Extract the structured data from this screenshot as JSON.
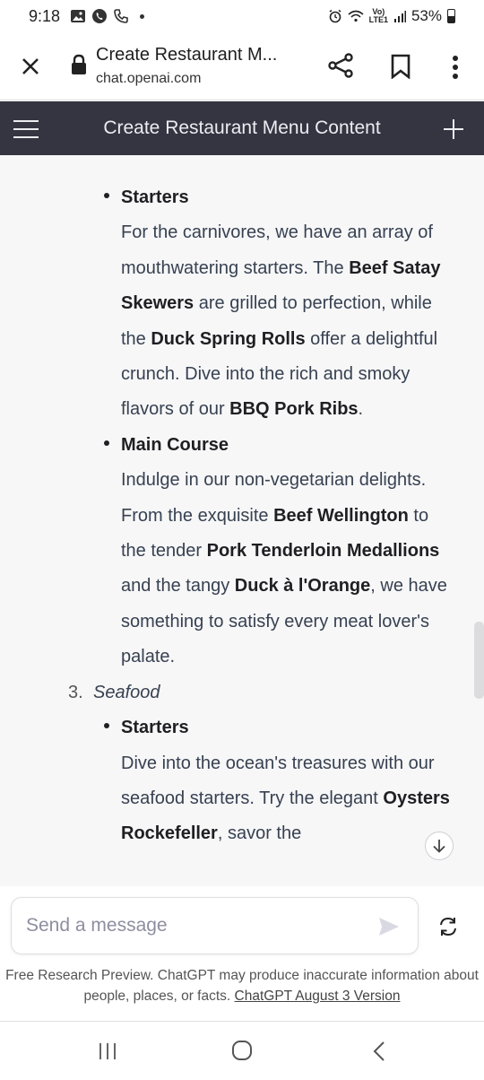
{
  "status_bar": {
    "time": "9:18",
    "network_top": "Vo)",
    "network_bottom": "LTE1",
    "battery": "53%"
  },
  "browser": {
    "tab_title": "Create Restaurant M...",
    "url": "chat.openai.com"
  },
  "chat_header": {
    "title": "Create Restaurant Menu Content"
  },
  "content": {
    "sections": [
      {
        "type": "bullet",
        "heading": "Starters",
        "paragraph": [
          {
            "t": "For the carnivores, we have an array of mouthwatering starters. The ",
            "b": false
          },
          {
            "t": "Beef Satay Skewers",
            "b": true
          },
          {
            "t": " are grilled to perfection, while the ",
            "b": false
          },
          {
            "t": "Duck Spring Rolls",
            "b": true
          },
          {
            "t": " offer a delightful crunch. Dive into the rich and smoky flavors of our ",
            "b": false
          },
          {
            "t": "BBQ Pork Ribs",
            "b": true
          },
          {
            "t": ".",
            "b": false
          }
        ]
      },
      {
        "type": "bullet",
        "heading": "Main Course",
        "paragraph": [
          {
            "t": "Indulge in our non-vegetarian delights. From the exquisite ",
            "b": false
          },
          {
            "t": "Beef Wellington",
            "b": true
          },
          {
            "t": " to the tender ",
            "b": false
          },
          {
            "t": "Pork Tenderloin Medallions",
            "b": true
          },
          {
            "t": " and the tangy ",
            "b": false
          },
          {
            "t": "Duck à l'Orange",
            "b": true
          },
          {
            "t": ", we have something to satisfy every meat lover's palate.",
            "b": false
          }
        ]
      },
      {
        "type": "numbered",
        "number": "3.",
        "heading": "Seafood"
      },
      {
        "type": "bullet",
        "heading": "Starters",
        "paragraph": [
          {
            "t": "Dive into the ocean's treasures with our seafood starters. Try the elegant ",
            "b": false
          },
          {
            "t": "Oysters Rockefeller",
            "b": true
          },
          {
            "t": ", savor the",
            "b": false
          }
        ]
      }
    ]
  },
  "composer": {
    "placeholder": "Send a message"
  },
  "disclaimer": {
    "text": "Free Research Preview. ChatGPT may produce inaccurate information about people, places, or facts. ",
    "link": "ChatGPT August 3 Version"
  },
  "icons": {
    "accent_dark": "#343541",
    "send_color": "#d9d9e3"
  }
}
